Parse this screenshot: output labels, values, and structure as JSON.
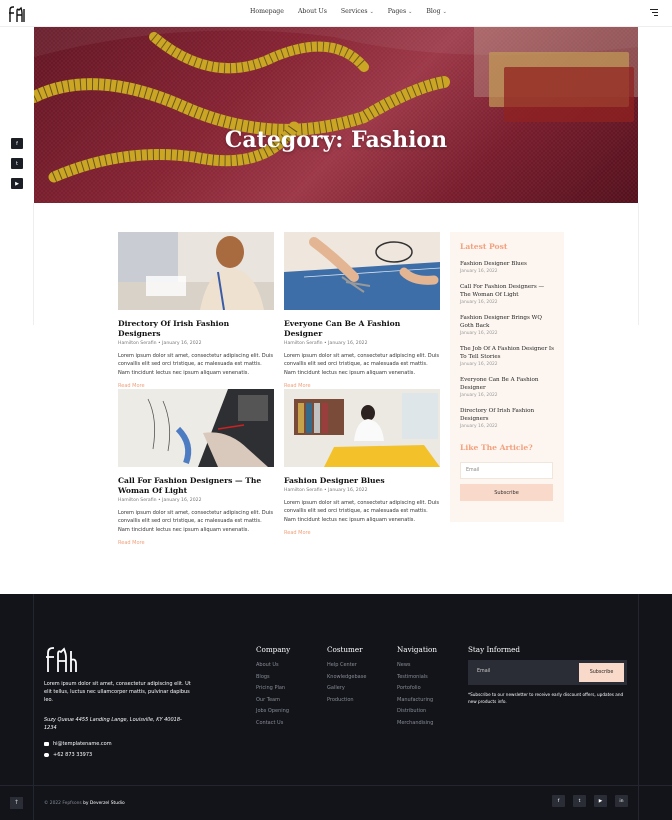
{
  "brand": {
    "logo_letters": "fh",
    "name": "Fepfsons"
  },
  "nav": {
    "items": [
      {
        "label": "Homepage",
        "has_caret": false
      },
      {
        "label": "About Us",
        "has_caret": false
      },
      {
        "label": "Services",
        "has_caret": true
      },
      {
        "label": "Pages",
        "has_caret": true
      },
      {
        "label": "Blog",
        "has_caret": true
      }
    ],
    "caret_glyph": "⌄"
  },
  "hero": {
    "title": "Category: Fashion"
  },
  "social_sticky": [
    {
      "icon": "facebook-icon",
      "glyph": "f"
    },
    {
      "icon": "twitter-icon",
      "glyph": "t"
    },
    {
      "icon": "youtube-icon",
      "glyph": "▶"
    }
  ],
  "posts": [
    {
      "title": "Directory Of Irish Fashion Designers",
      "meta": "Hamilton Serafin • January 16, 2022",
      "excerpt": "Lorem ipsum dolor sit amet, consectetur adipiscing elit. Duis convallis elit sed orci tristique, ac malesuada est mattis. Nam tincidunt lectus nec ipsum aliquam venenatis.",
      "more": "Read More"
    },
    {
      "title": "Everyone Can Be A Fashion Designer",
      "meta": "Hamilton Serafin • January 16, 2022",
      "excerpt": "Lorem ipsum dolor sit amet, consectetur adipiscing elit. Duis convallis elit sed orci tristique, ac malesuada est mattis. Nam tincidunt lectus nec ipsum aliquam venenatis.",
      "more": "Read More"
    },
    {
      "title": "Call For Fashion Designers — The Woman Of Light",
      "meta": "Hamilton Serafin • January 16, 2022",
      "excerpt": "Lorem ipsum dolor sit amet, consectetur adipiscing elit. Duis convallis elit sed orci tristique, ac malesuada est mattis. Nam tincidunt lectus nec ipsum aliquam venenatis.",
      "more": "Read More"
    },
    {
      "title": "Fashion Designer Blues",
      "meta": "Hamilton Serafin • January 16, 2022",
      "excerpt": "Lorem ipsum dolor sit amet, consectetur adipiscing elit. Duis convallis elit sed orci tristique, ac malesuada est mattis. Nam tincidunt lectus nec ipsum aliquam venenatis.",
      "more": "Read More"
    }
  ],
  "sidebar": {
    "latest_heading": "Latest Post",
    "latest": [
      {
        "title": "Fashion Designer Blues",
        "date": "January 16, 2022"
      },
      {
        "title": "Call For Fashion Designers — The Woman Of Light",
        "date": "January 16, 2022"
      },
      {
        "title": "Fashion Designer Brings WQ Goth Back",
        "date": "January 16, 2022"
      },
      {
        "title": "The Job Of A Fashion Designer Is To Tell Stories",
        "date": "January 16, 2022"
      },
      {
        "title": "Everyone Can Be A Fashion Designer",
        "date": "January 16, 2022"
      },
      {
        "title": "Directory Of Irish Fashion Designers",
        "date": "January 16, 2022"
      }
    ],
    "like_heading": "Like The Article?",
    "email_placeholder": "Email",
    "subscribe_label": "Subscribe"
  },
  "footer": {
    "about": "Lorem ipsum dolor sit amet, consectetur adipiscing elit. Ut elit tellus, luctus nec ullamcorper mattis, pulvinar dapibus leo.",
    "address": "Suzy Queue 4455 Landing Lange, Louisville, KY 40018-1234",
    "email": "hi@templatename.com",
    "phone": "+62 873 33973",
    "columns": [
      {
        "heading": "Company",
        "links": [
          "About Us",
          "Blogs",
          "Pricing Plan",
          "Our Team",
          "Jobs Opening",
          "Contact Us"
        ]
      },
      {
        "heading": "Costumer",
        "links": [
          "Help Center",
          "Knowledgebase",
          "Gallery",
          "Production"
        ]
      },
      {
        "heading": "Navigation",
        "links": [
          "News",
          "Testimonials",
          "Portofolio",
          "Manufacturing",
          "Distribution",
          "Merchandising"
        ]
      }
    ],
    "stay": {
      "heading": "Stay Informed",
      "email_placeholder": "Email",
      "subscribe_label": "Subscribe",
      "note": "*Subscribe to our newsletter to receive early discount offers, updates and new products info."
    },
    "copyright_prefix": "© 2022 Fepfsons",
    "copyright_by": "by Deverzel Studio",
    "up_glyph": "🡑",
    "social": [
      {
        "icon": "facebook-icon",
        "glyph": "f"
      },
      {
        "icon": "twitter-icon",
        "glyph": "t"
      },
      {
        "icon": "youtube-icon",
        "glyph": "▶"
      },
      {
        "icon": "linkedin-icon",
        "glyph": "in"
      }
    ]
  },
  "colors": {
    "accent": "#f2a07e",
    "footer_bg": "#12141a",
    "sidebar_bg": "#fdf6f0",
    "subscribe_bg": "#f9d9c9"
  }
}
